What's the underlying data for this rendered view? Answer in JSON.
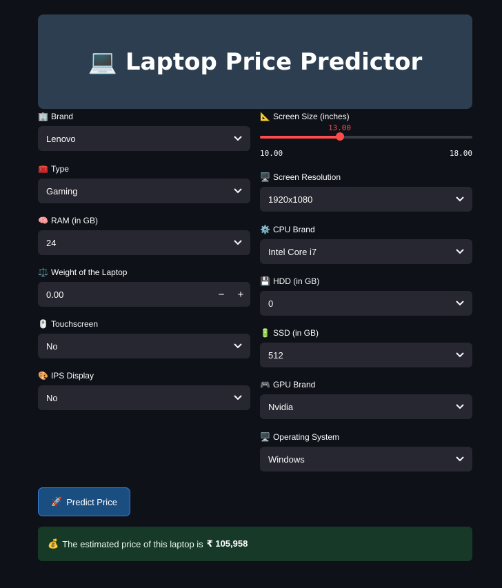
{
  "header": {
    "icon": "💻",
    "title": "Laptop Price Predictor"
  },
  "left": [
    {
      "emoji": "🏢",
      "label": "Brand",
      "value": "Lenovo",
      "kind": "select"
    },
    {
      "emoji": "🧰",
      "label": "Type",
      "value": "Gaming",
      "kind": "select"
    },
    {
      "emoji": "🧠",
      "label": "RAM (in GB)",
      "value": "24",
      "kind": "select"
    },
    {
      "emoji": "⚖️",
      "label": "Weight of the Laptop",
      "value": "0.00",
      "kind": "number"
    },
    {
      "emoji": "🖱️",
      "label": "Touchscreen",
      "value": "No",
      "kind": "select"
    },
    {
      "emoji": "🎨",
      "label": "IPS Display",
      "value": "No",
      "kind": "select"
    }
  ],
  "screen_size": {
    "emoji": "📐",
    "label": "Screen Size (inches)",
    "value": "13.00",
    "min": "10.00",
    "max": "18.00",
    "numeric": {
      "value": 13.0,
      "min": 10.0,
      "max": 18.0
    }
  },
  "right": [
    {
      "emoji": "🖥️",
      "label": "Screen Resolution",
      "value": "1920x1080"
    },
    {
      "emoji": "⚙️",
      "label": "CPU Brand",
      "value": "Intel Core i7"
    },
    {
      "emoji": "💾",
      "label": "HDD (in GB)",
      "value": "0"
    },
    {
      "emoji": "🔋",
      "label": "SSD (in GB)",
      "value": "512"
    },
    {
      "emoji": "🎮",
      "label": "GPU Brand",
      "value": "Nvidia"
    },
    {
      "emoji": "🖥️",
      "label": "Operating System",
      "value": "Windows"
    }
  ],
  "predict": {
    "emoji": "🚀",
    "label": "Predict Price"
  },
  "result": {
    "emoji": "💰",
    "text": "The estimated price of this laptop is",
    "price": "₹ 105,958"
  },
  "colors": {
    "accent": "#ff4b4b",
    "bg": "#0e1117",
    "input": "#262730",
    "header": "#2c3e50",
    "success_bg": "#173928",
    "button": "#1a4d80"
  }
}
